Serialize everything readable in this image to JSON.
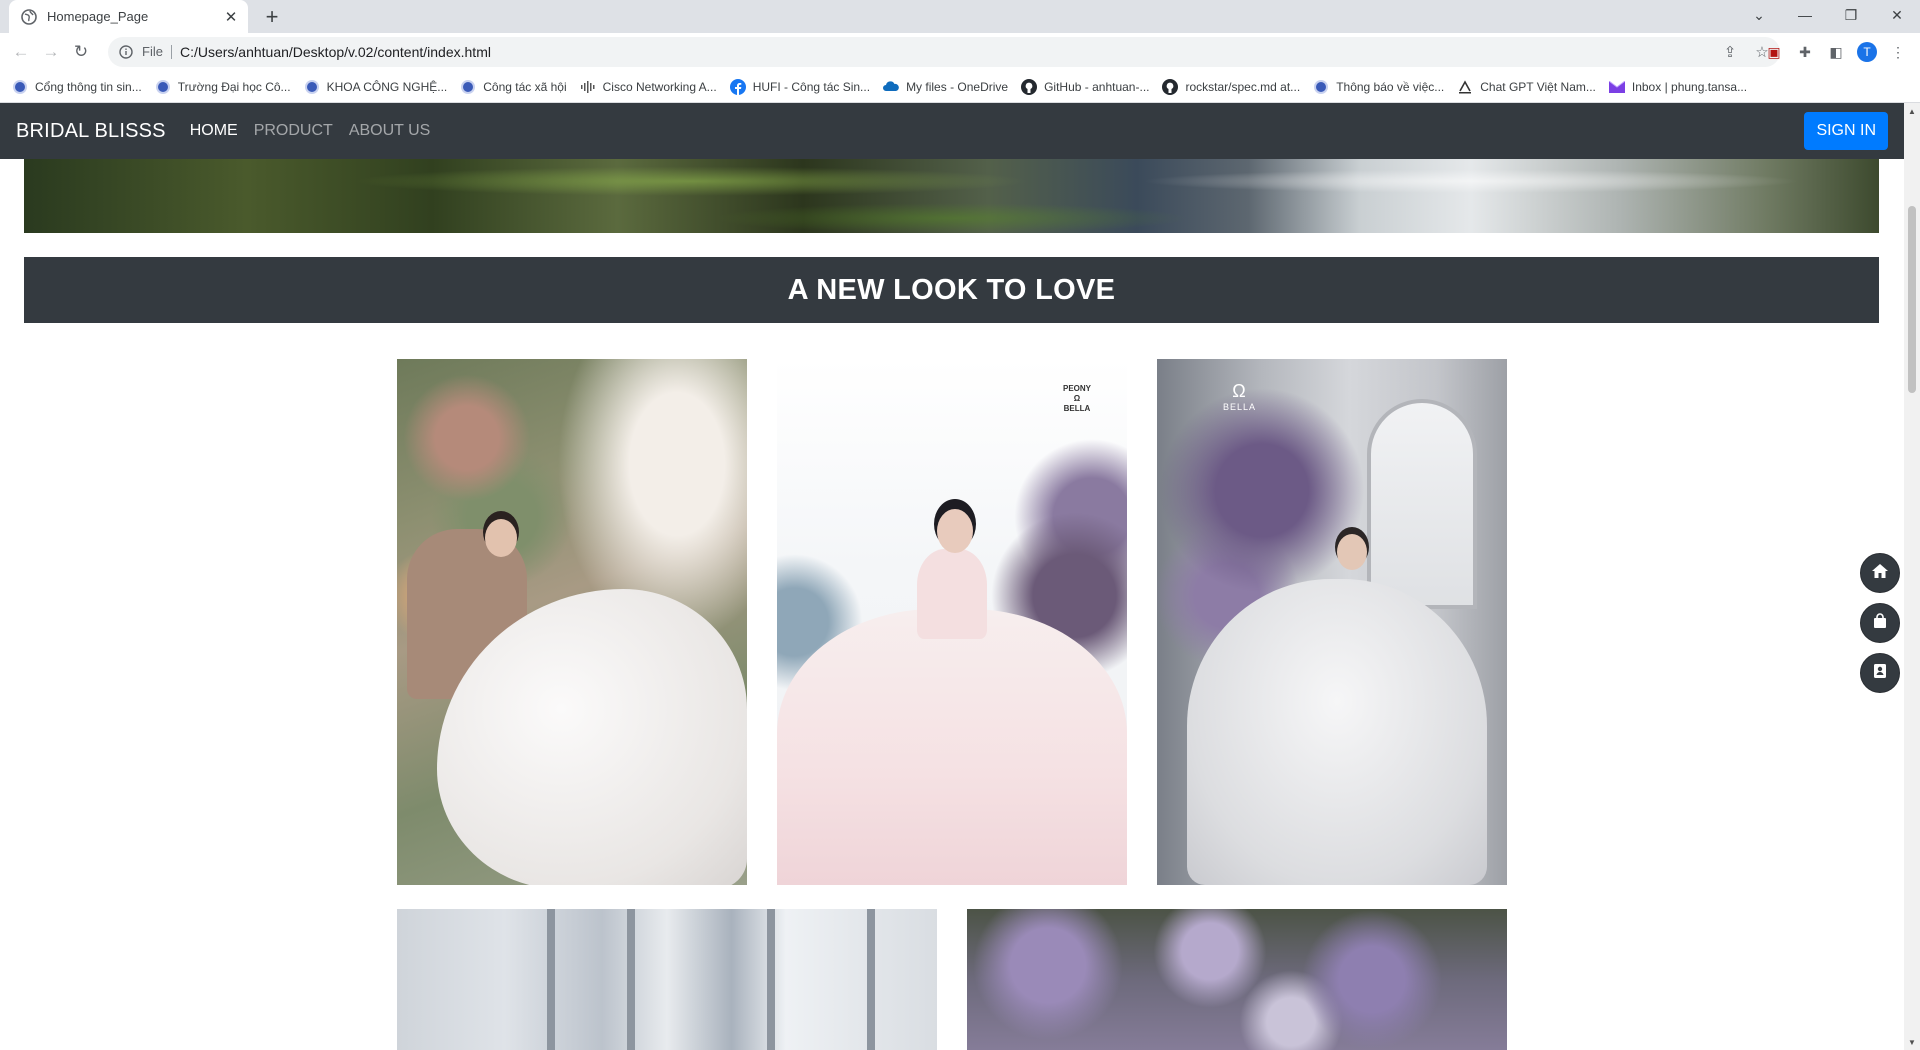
{
  "browser": {
    "tab_title": "Homepage_Page",
    "new_tab": "+",
    "url_scheme": "File",
    "url": "C:/Users/anhtuan/Desktop/v.02/content/index.html",
    "profile_initial": "T"
  },
  "bookmarks": [
    {
      "label": "Cổng thông tin sin...",
      "icon": "university-icon"
    },
    {
      "label": "Trường Đại học Cô...",
      "icon": "university-icon"
    },
    {
      "label": "KHOA CÔNG NGHỆ...",
      "icon": "university-icon"
    },
    {
      "label": "Công tác xã hội",
      "icon": "university-icon"
    },
    {
      "label": "Cisco Networking A...",
      "icon": "cisco-icon"
    },
    {
      "label": "HUFI - Công tác Sin...",
      "icon": "facebook-icon"
    },
    {
      "label": "My files - OneDrive",
      "icon": "onedrive-icon"
    },
    {
      "label": "GitHub - anhtuan-...",
      "icon": "github-icon"
    },
    {
      "label": "rockstar/spec.md at...",
      "icon": "github-icon"
    },
    {
      "label": "Thông báo về việc...",
      "icon": "university-icon"
    },
    {
      "label": "Chat GPT Việt Nam...",
      "icon": "chatgpt-icon"
    },
    {
      "label": "Inbox | phung.tansa...",
      "icon": "mail-icon"
    }
  ],
  "site": {
    "brand": "BRIDAL BLISSS",
    "nav": [
      "HOME",
      "PRODUCT",
      "ABOUT US"
    ],
    "active_nav": "HOME",
    "sign_in": "SIGN IN",
    "section_title": "A NEW LOOK TO LOVE",
    "photo2_logo_top": "PEONY",
    "photo2_logo_bottom": "BELLA",
    "photo3_logo": "BELLA"
  },
  "floating_buttons": [
    "home-icon",
    "shopping-bag-icon",
    "contact-book-icon"
  ],
  "colors": {
    "navbar": "#343a40",
    "accent": "#007bff",
    "nav_active": "#ffffff",
    "nav_inactive": "rgba(255,255,255,.55)"
  }
}
